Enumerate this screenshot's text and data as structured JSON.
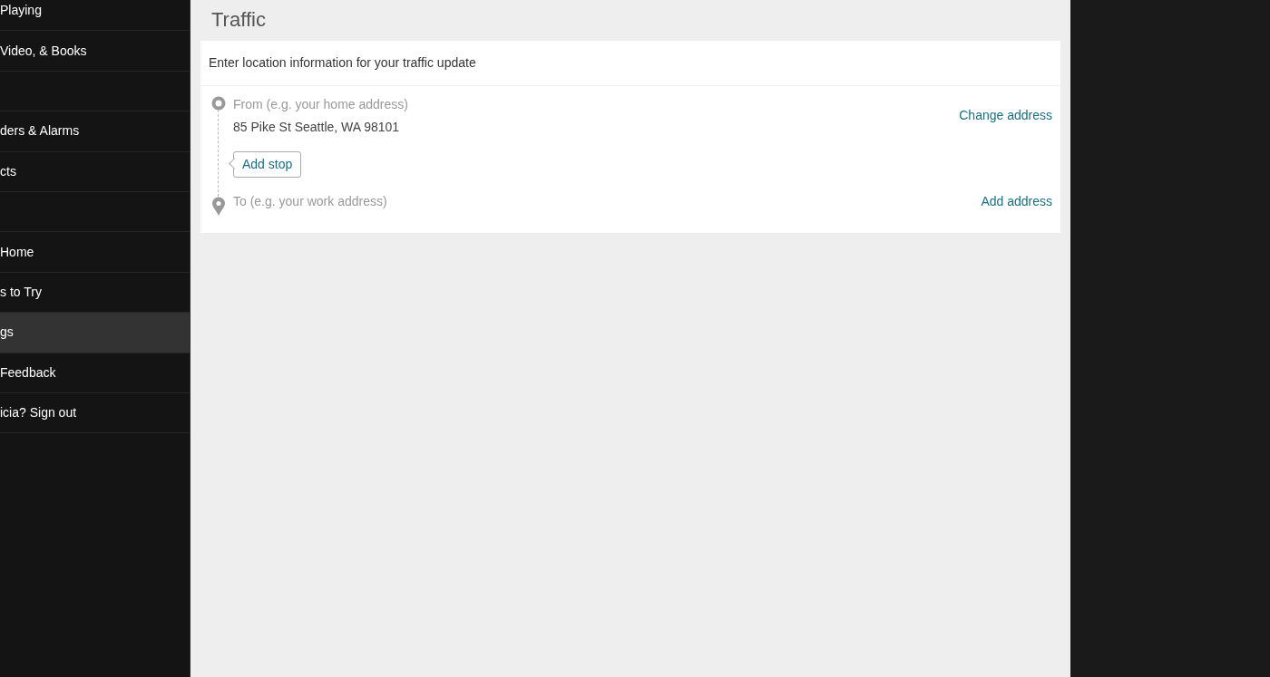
{
  "sidebar": {
    "items": [
      {
        "label": "Playing",
        "selected": false
      },
      {
        "label": "Video, & Books",
        "selected": false
      },
      {
        "selected": false
      },
      {
        "label": "ders & Alarms",
        "selected": false
      },
      {
        "label": "cts",
        "selected": false
      },
      {
        "selected": false
      },
      {
        "label": "Home",
        "selected": false
      },
      {
        "label": "s to Try",
        "selected": false
      },
      {
        "label": "gs",
        "selected": true
      },
      {
        "label": "Feedback",
        "selected": false
      },
      {
        "label": "icia? Sign out",
        "selected": false
      }
    ]
  },
  "page": {
    "title": "Traffic"
  },
  "card": {
    "heading": "Enter location information for your traffic update",
    "from": {
      "placeholder": "From (e.g. your home address)",
      "value": "85 Pike St Seattle, WA 98101",
      "action": "Change address"
    },
    "add_stop": "Add stop",
    "to": {
      "placeholder": "To (e.g. your work address)",
      "action": "Add address"
    }
  }
}
